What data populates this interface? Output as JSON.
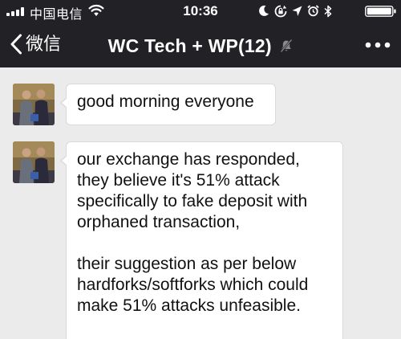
{
  "status_bar": {
    "carrier": "中国电信",
    "time": "10:36"
  },
  "nav": {
    "back_label": "微信",
    "title": "WC Tech + WP(12)"
  },
  "messages": [
    {
      "text": "good morning everyone"
    },
    {
      "text": "our exchange has responded, they believe it's 51% attack specifically to fake deposit with orphaned transaction,\n\ntheir suggestion as per below hardforks/softforks which could make 51% attacks unfeasible."
    }
  ],
  "colors": {
    "header_bg": "#222226",
    "chat_bg": "#ebebeb",
    "bubble_bg": "#ffffff",
    "text": "#111111"
  },
  "icons": [
    "signal-icon",
    "wifi-icon",
    "moon-icon",
    "rotation-lock-icon",
    "location-arrow-icon",
    "alarm-icon",
    "bluetooth-icon",
    "battery-icon",
    "back-chevron-icon",
    "mute-icon",
    "more-icon"
  ]
}
